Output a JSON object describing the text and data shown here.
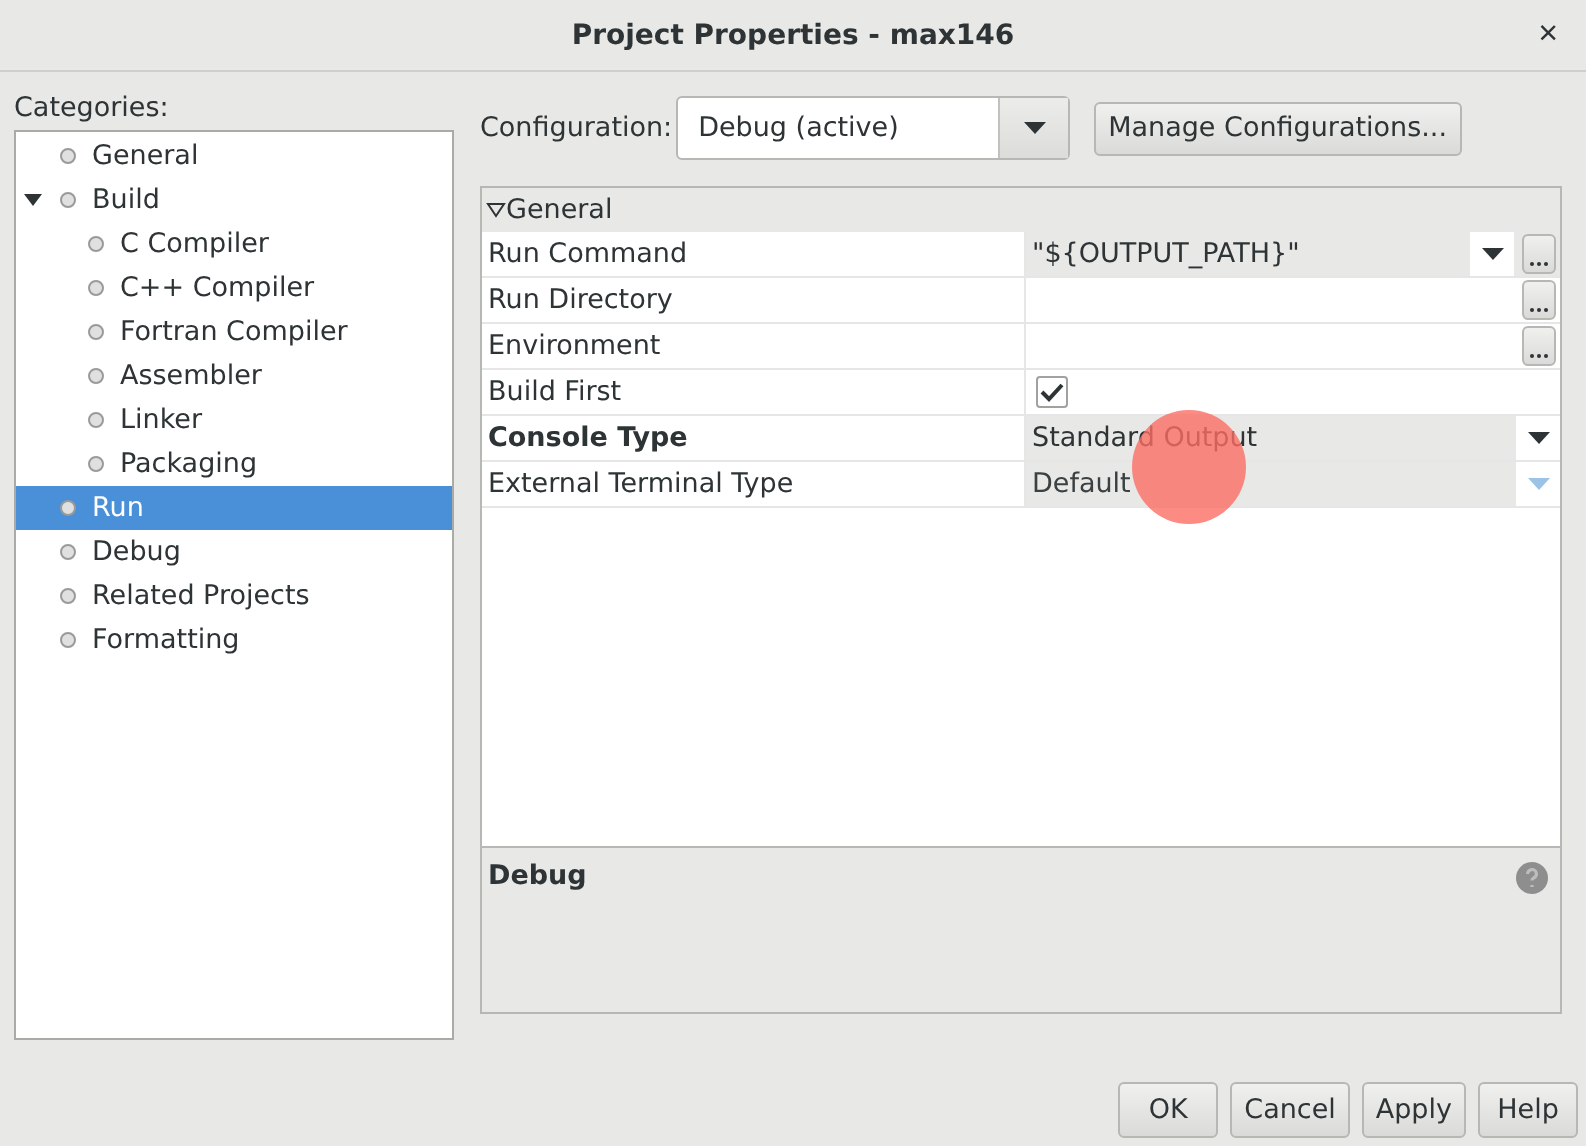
{
  "window": {
    "title": "Project Properties - max146",
    "close": "×"
  },
  "categories": {
    "label": "Categories:",
    "items": [
      {
        "label": "General",
        "selected": false
      },
      {
        "label": "Build",
        "selected": false,
        "expanded": true,
        "children": [
          {
            "label": "C Compiler",
            "selected": false
          },
          {
            "label": "C++ Compiler",
            "selected": false
          },
          {
            "label": "Fortran Compiler",
            "selected": false
          },
          {
            "label": "Assembler",
            "selected": false
          },
          {
            "label": "Linker",
            "selected": false
          },
          {
            "label": "Packaging",
            "selected": false
          }
        ]
      },
      {
        "label": "Run",
        "selected": true
      },
      {
        "label": "Debug",
        "selected": false
      },
      {
        "label": "Related Projects",
        "selected": false
      },
      {
        "label": "Formatting",
        "selected": false
      }
    ]
  },
  "configuration": {
    "label": "Configuration:",
    "value": "Debug (active)",
    "manage_button": "Manage Configurations..."
  },
  "properties": {
    "section": "General",
    "expanded": true,
    "rows": [
      {
        "kind": "editable",
        "name": "Run Command",
        "value": "\"${OUTPUT_PATH}\"",
        "modified": false
      },
      {
        "kind": "button",
        "name": "Run Directory",
        "modified": false
      },
      {
        "kind": "button",
        "name": "Environment",
        "modified": false
      },
      {
        "kind": "checkbox",
        "name": "Build First",
        "checked": true,
        "modified": false
      },
      {
        "kind": "combo",
        "name": "Console Type",
        "value": "Standard Output",
        "modified": true,
        "disabled": false
      },
      {
        "kind": "combo",
        "name": "External Terminal Type",
        "value": "Default",
        "modified": false,
        "disabled": true
      }
    ]
  },
  "description": {
    "title": "Debug"
  },
  "buttons": [
    "OK",
    "Cancel",
    "Apply",
    "Help"
  ]
}
